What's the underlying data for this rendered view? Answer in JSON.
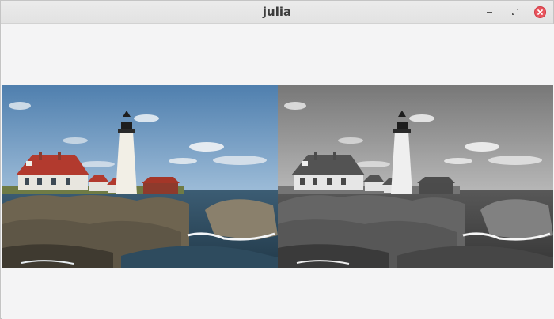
{
  "window": {
    "title": "julia"
  },
  "controls": {
    "minimize_icon": "minimize-icon",
    "maximize_icon": "maximize-icon",
    "close_icon": "close-icon",
    "close_color": "#e8545d"
  },
  "images": {
    "left_mode": "color",
    "right_mode": "grayscale"
  }
}
